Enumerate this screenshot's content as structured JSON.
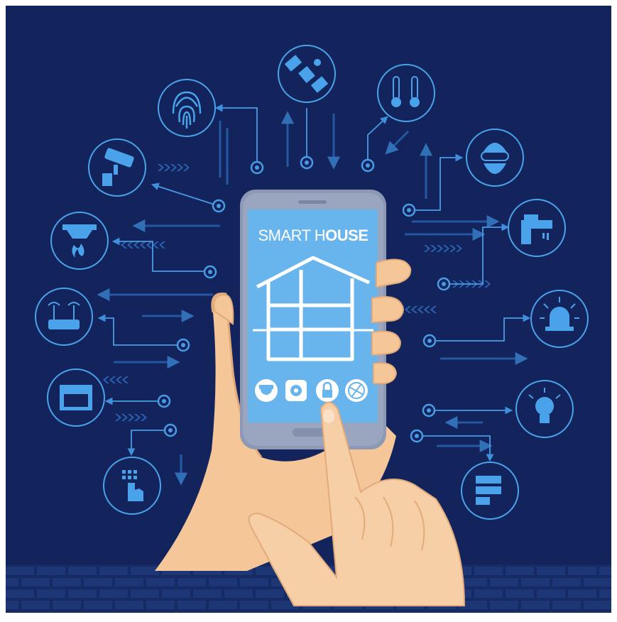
{
  "title": {
    "part1": "SMART H",
    "part2": "USE"
  },
  "colors": {
    "background": "#13245c",
    "line": "#3f8fdc",
    "icon_fill": "#4aa3ea",
    "screen": "#68b4ec",
    "phone_body": "#8c98b4",
    "skin": "#f4c698",
    "skin_shadow": "#e3aa7a"
  },
  "icons": {
    "left": [
      "fingerprint-icon",
      "security-camera-icon",
      "smoke-detector-icon",
      "wifi-router-icon",
      "oven-icon",
      "keypad-icon"
    ],
    "top": [
      "satellite-icon",
      "thermometer-icon"
    ],
    "right": [
      "burglar-icon",
      "faucet-icon",
      "alarm-siren-icon",
      "light-bulb-icon",
      "battery-icon"
    ]
  },
  "app_buttons": [
    "camera-app-icon",
    "settings-app-icon",
    "lock-app-icon",
    "network-app-icon"
  ]
}
